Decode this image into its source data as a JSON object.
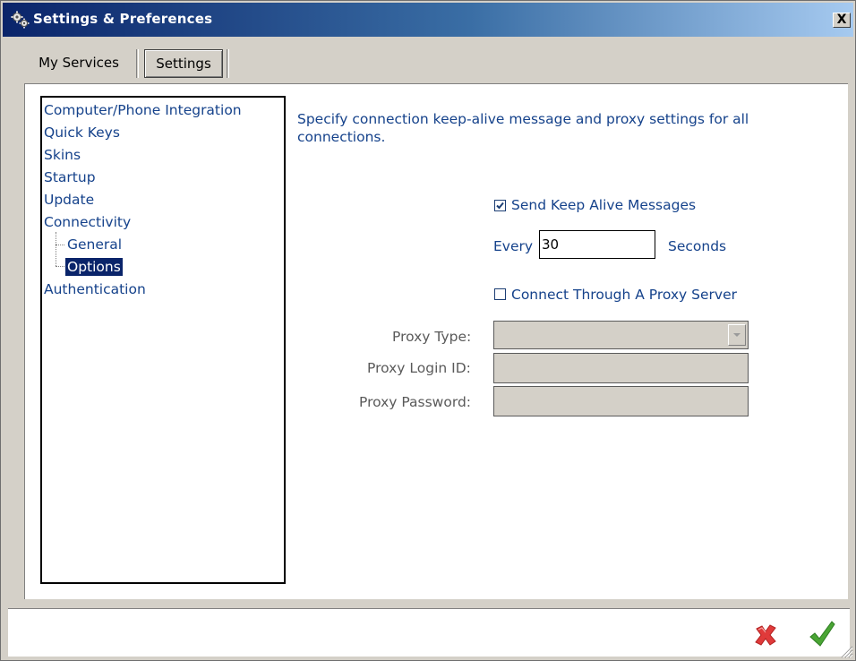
{
  "window": {
    "title": "Settings & Preferences",
    "close_label": "X"
  },
  "tabs": [
    {
      "label": "My Services",
      "active": false
    },
    {
      "label": "Settings",
      "active": true
    }
  ],
  "sidebar": {
    "items": [
      {
        "label": "Computer/Phone Integration"
      },
      {
        "label": "Quick Keys"
      },
      {
        "label": "Skins"
      },
      {
        "label": "Startup"
      },
      {
        "label": "Update"
      },
      {
        "label": "Connectivity"
      },
      {
        "label": "General"
      },
      {
        "label": "Options",
        "selected": true
      },
      {
        "label": "Authentication"
      }
    ]
  },
  "main": {
    "description": "Specify connection keep-alive message and proxy settings for all connections.",
    "keep_alive": {
      "label": "Send Keep Alive Messages",
      "checked": true
    },
    "interval": {
      "prefix": "Every",
      "value": "30",
      "suffix": "Seconds"
    },
    "proxy": {
      "label": "Connect Through A Proxy Server",
      "checked": false
    },
    "proxy_type_label": "Proxy Type:",
    "proxy_login_label": "Proxy Login ID:",
    "proxy_password_label": "Proxy Password:"
  },
  "colors": {
    "label_blue": "#15428b",
    "selection": "#0a246a",
    "cancel": "#e03a3a",
    "ok": "#4aa534"
  },
  "icons": [
    "gears-icon",
    "cancel-x-icon",
    "ok-check-icon",
    "resize-grip-icon"
  ]
}
